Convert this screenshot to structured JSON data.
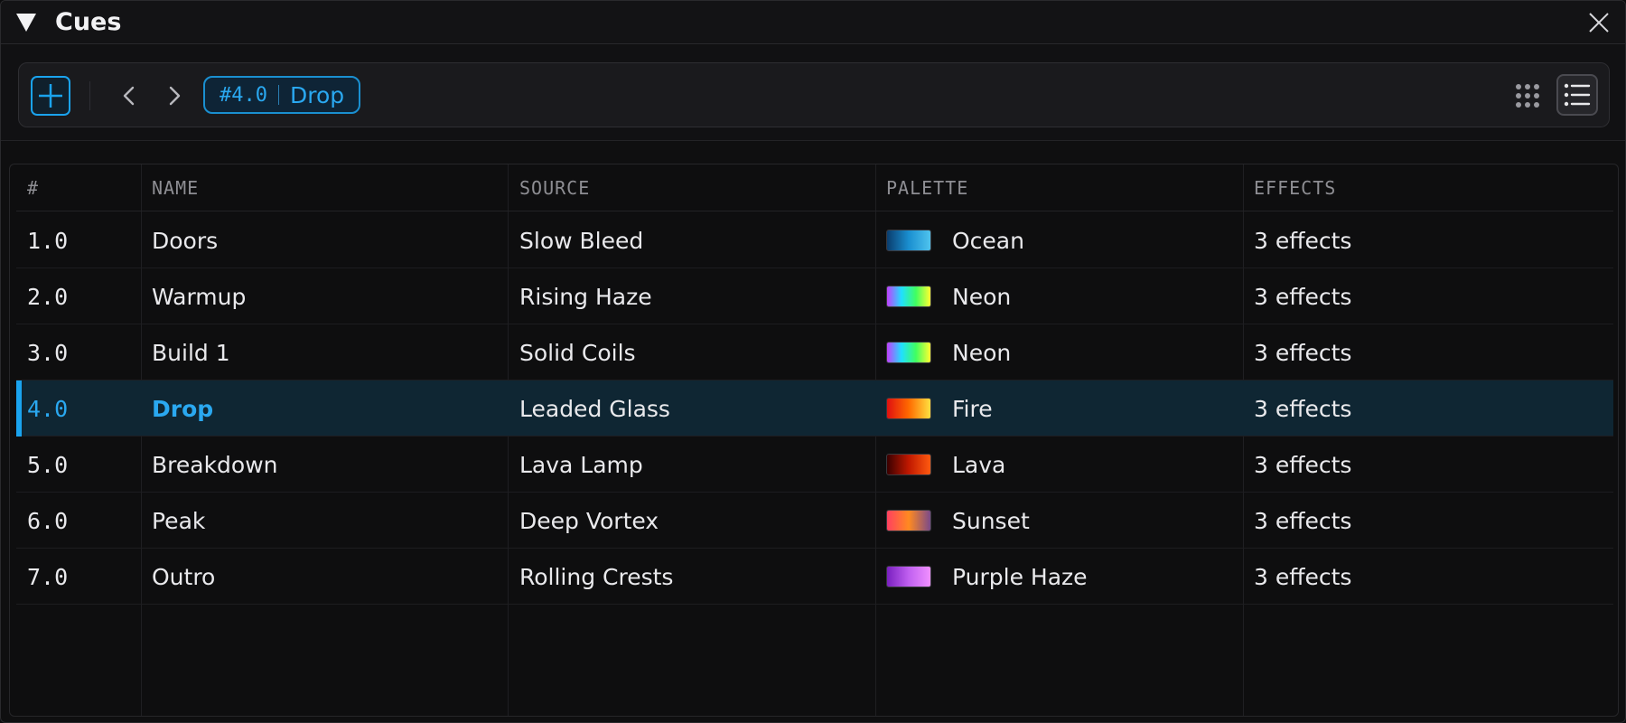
{
  "panel": {
    "title": "Cues"
  },
  "toolbar": {
    "current_cue": {
      "number": "#4.0",
      "name": "Drop"
    }
  },
  "table": {
    "columns": [
      "#",
      "NAME",
      "SOURCE",
      "PALETTE",
      "EFFECTS"
    ],
    "rows": [
      {
        "number": "1.0",
        "name": "Doors",
        "source": "Slow Bleed",
        "palette": "Ocean",
        "palette_colors": [
          "#0a3d6e",
          "#1a8fd0",
          "#4fc3ee"
        ],
        "effects": "3 effects",
        "selected": false
      },
      {
        "number": "2.0",
        "name": "Warmup",
        "source": "Rising Haze",
        "palette": "Neon",
        "palette_colors": [
          "#c040ff",
          "#20e0ff",
          "#40ff60",
          "#ffff30"
        ],
        "effects": "3 effects",
        "selected": false
      },
      {
        "number": "3.0",
        "name": "Build 1",
        "source": "Solid Coils",
        "palette": "Neon",
        "palette_colors": [
          "#c040ff",
          "#20e0ff",
          "#40ff60",
          "#ffff30"
        ],
        "effects": "3 effects",
        "selected": false
      },
      {
        "number": "4.0",
        "name": "Drop",
        "source": "Leaded Glass",
        "palette": "Fire",
        "palette_colors": [
          "#e01010",
          "#ff6a00",
          "#ffe040"
        ],
        "effects": "3 effects",
        "selected": true
      },
      {
        "number": "5.0",
        "name": "Breakdown",
        "source": "Lava Lamp",
        "palette": "Lava",
        "palette_colors": [
          "#3a0000",
          "#c01800",
          "#ff5a10"
        ],
        "effects": "3 effects",
        "selected": false
      },
      {
        "number": "6.0",
        "name": "Peak",
        "source": "Deep Vortex",
        "palette": "Sunset",
        "palette_colors": [
          "#ff4060",
          "#ff8a20",
          "#7a4a8a"
        ],
        "effects": "3 effects",
        "selected": false
      },
      {
        "number": "7.0",
        "name": "Outro",
        "source": "Rolling Crests",
        "palette": "Purple Haze",
        "palette_colors": [
          "#7a20c0",
          "#c060f0",
          "#f090ff"
        ],
        "effects": "3 effects",
        "selected": false
      }
    ]
  },
  "colors": {
    "accent": "#1aa3ee",
    "selected_row_bg": "#0f2633"
  },
  "icons": {
    "collapse": "triangle-down-icon",
    "close": "close-icon",
    "add": "plus-icon",
    "prev": "chevron-left-icon",
    "next": "chevron-right-icon",
    "grid_view": "grid-icon",
    "list_view": "list-icon"
  }
}
